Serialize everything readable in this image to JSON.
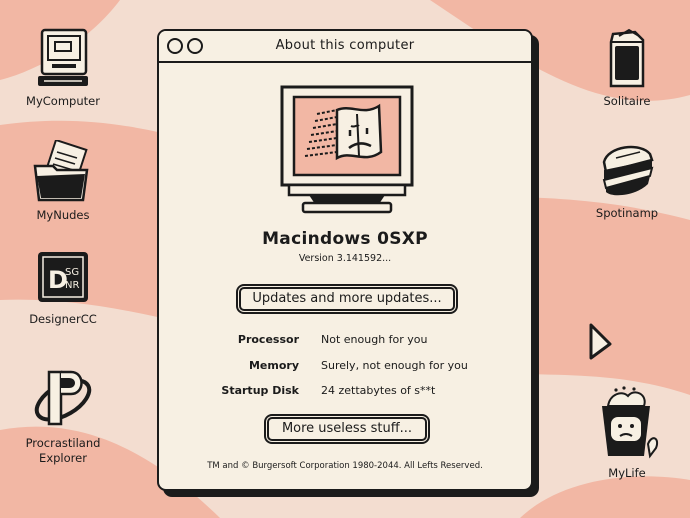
{
  "desktop": {
    "left_icons": [
      {
        "label": "MyComputer",
        "icon": "computer-icon"
      },
      {
        "label": "MyNudes",
        "icon": "folder-icon"
      },
      {
        "label": "DesignerCC",
        "icon": "designer-app-icon",
        "logo_text": "DSGNR"
      },
      {
        "label": "Procrastiland\nExplorer",
        "icon": "browser-icon"
      }
    ],
    "right_icons": [
      {
        "label": "Solitaire",
        "icon": "cards-icon"
      },
      {
        "label": "Spotinamp",
        "icon": "sandwich-icon"
      },
      {
        "label": "MyLife",
        "icon": "trash-bin-icon"
      }
    ]
  },
  "window": {
    "title": "About this computer",
    "product_name": "Macindows 0SXP",
    "version": "Version 3.141592...",
    "updates_button": "Updates and more updates...",
    "specs": [
      {
        "label": "Processor",
        "value": "Not enough for you"
      },
      {
        "label": "Memory",
        "value": "Surely, not enough for you"
      },
      {
        "label": "Startup Disk",
        "value": "24 zettabytes of s**t"
      }
    ],
    "more_button": "More useless stuff...",
    "copyright": "TM and © Burgersoft Corporation 1980-2044. All Lefts Reserved."
  },
  "colors": {
    "background": "#f3ddd0",
    "stripe": "#f2b7a4",
    "window": "#f7f0e3",
    "screen": "#f2b7a4",
    "ink": "#1b1b1b"
  }
}
